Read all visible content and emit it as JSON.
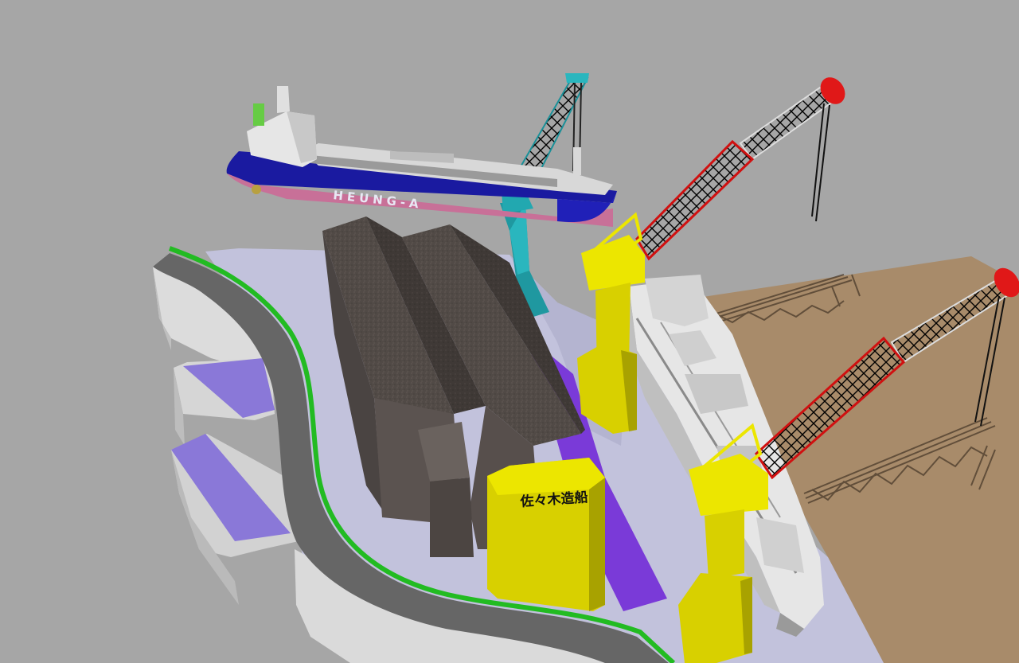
{
  "scene": {
    "ship_hull_label": "HEUNG-A",
    "building_sign": "佐々木造船"
  },
  "colors": {
    "background": "#a6a6a6",
    "quay": "#c2c2dc",
    "water": "#a88b6a",
    "road": "#666666",
    "road_edge": "#22bb22",
    "shed_roof": "#514a46",
    "crane_pedestal": "#d8d000",
    "crane_boom_red": "#e01818",
    "crane_boom_white": "#f4f4f4",
    "teal_crane": "#22a8b0",
    "ship_hull_blue": "#1a1aa0",
    "ship_hull_pink": "#c87098",
    "purple_zone": "#8a78d8"
  }
}
